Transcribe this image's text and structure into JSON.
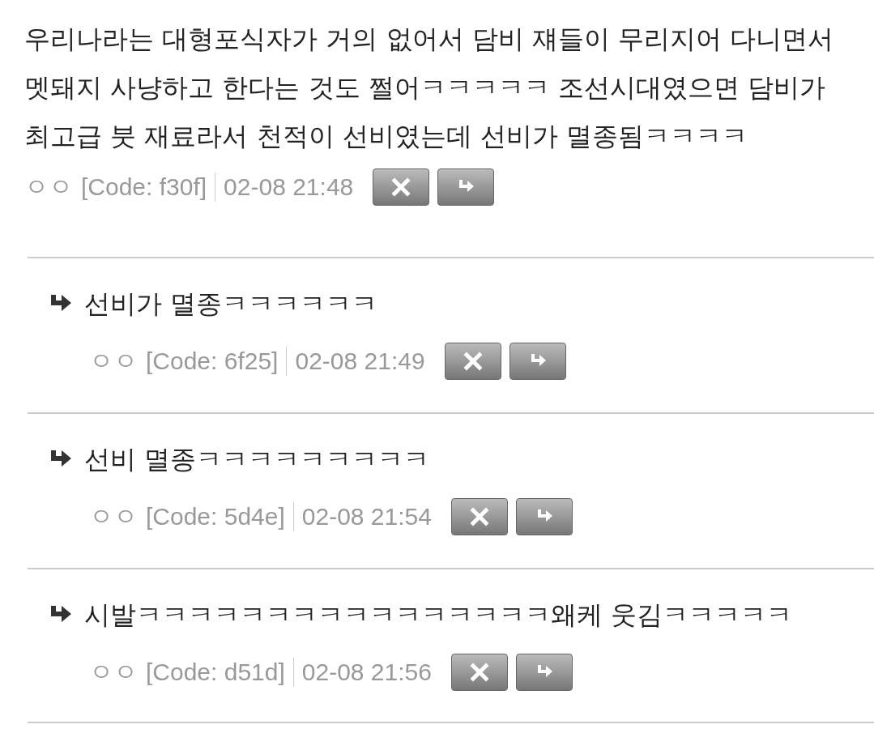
{
  "comment": {
    "text": "우리나라는 대형포식자가 거의 없어서 담비 쟤들이 무리지어 다니면서 멧돼지 사냥하고 한다는 것도 쩔어ㅋㅋㅋㅋㅋ 조선시대였으면 담비가 최고급 붓 재료라서 천적이 선비였는데 선비가 멸종됨ㅋㅋㅋㅋ",
    "author": "ㅇㅇ",
    "code": "[Code: f30f]",
    "time": "02-08 21:48"
  },
  "replies": [
    {
      "text": "선비가 멸종ㅋㅋㅋㅋㅋㅋ",
      "author": "ㅇㅇ",
      "code": "[Code: 6f25]",
      "time": "02-08 21:49"
    },
    {
      "text": "선비 멸종ㅋㅋㅋㅋㅋㅋㅋㅋㅋ",
      "author": "ㅇㅇ",
      "code": "[Code: 5d4e]",
      "time": "02-08 21:54"
    },
    {
      "text": "시발ㅋㅋㅋㅋㅋㅋㅋㅋㅋㅋㅋㅋㅋㅋㅋㅋ왜케 웃김ㅋㅋㅋㅋㅋ",
      "author": "ㅇㅇ",
      "code": "[Code: d51d]",
      "time": "02-08 21:56"
    }
  ]
}
